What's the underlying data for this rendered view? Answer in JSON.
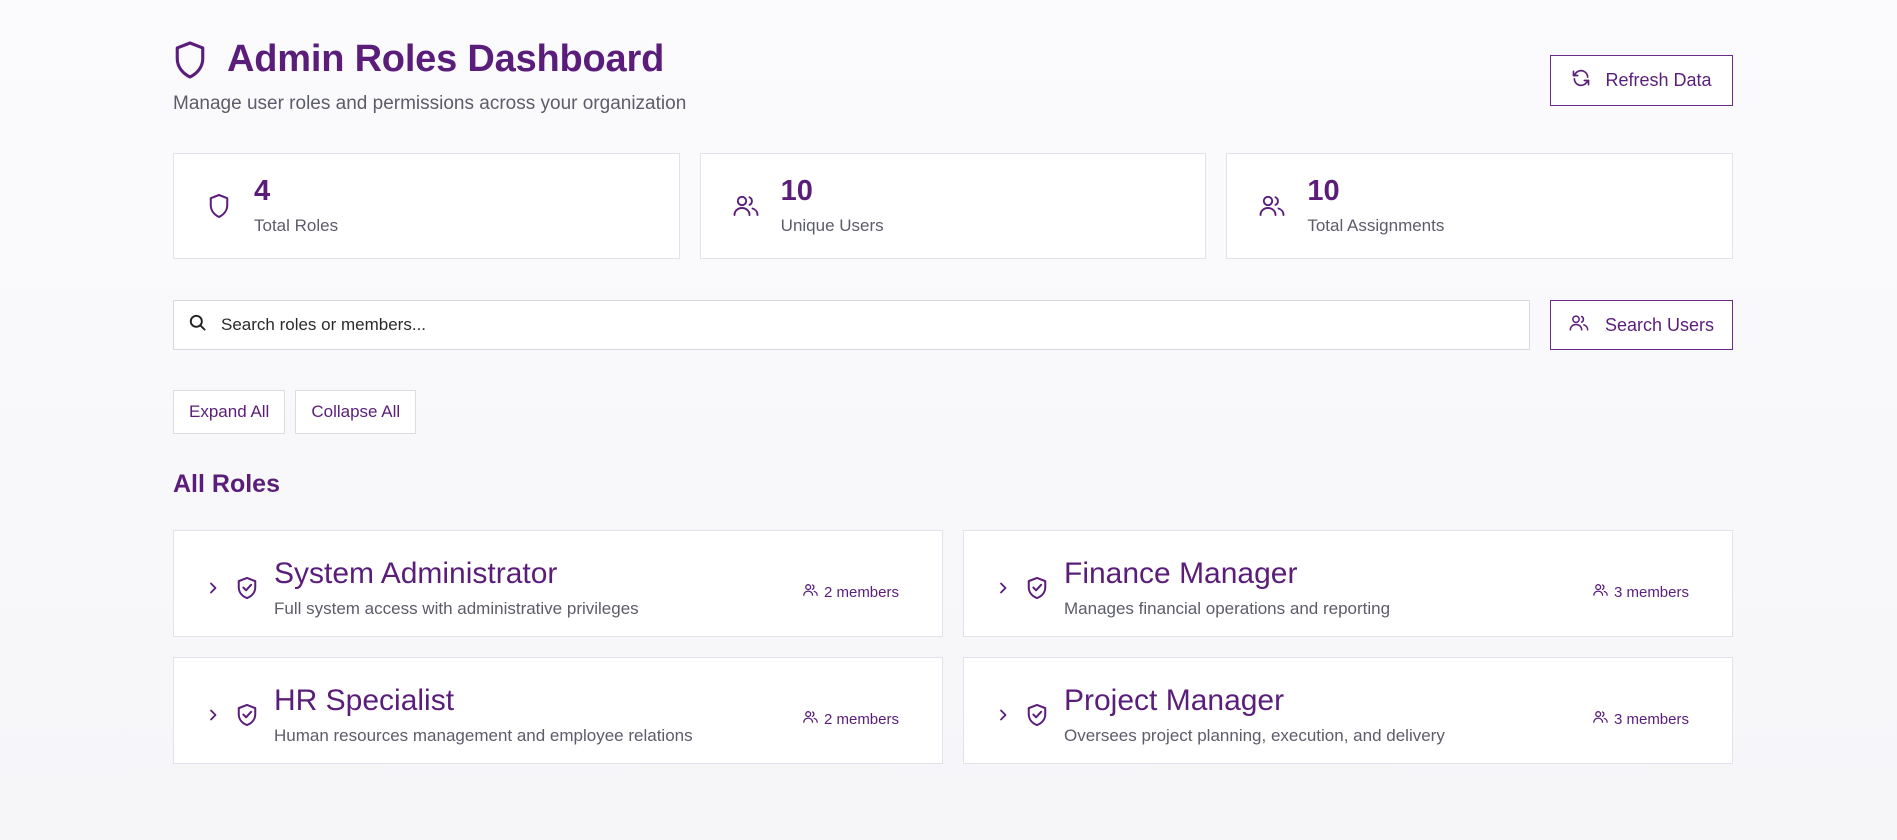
{
  "header": {
    "title": "Admin Roles Dashboard",
    "subtitle": "Manage user roles and permissions across your organization",
    "refresh_label": "Refresh Data"
  },
  "stats": [
    {
      "value": "4",
      "label": "Total Roles",
      "icon": "shield-icon"
    },
    {
      "value": "10",
      "label": "Unique Users",
      "icon": "users-icon"
    },
    {
      "value": "10",
      "label": "Total Assignments",
      "icon": "users-icon"
    }
  ],
  "search": {
    "placeholder": "Search roles or members...",
    "value": "",
    "search_users_label": "Search Users"
  },
  "toggles": {
    "expand_all": "Expand All",
    "collapse_all": "Collapse All"
  },
  "section_title": "All Roles",
  "roles": [
    {
      "name": "System Administrator",
      "description": "Full system access with administrative privileges",
      "members": "2 members"
    },
    {
      "name": "Finance Manager",
      "description": "Manages financial operations and reporting",
      "members": "3 members"
    },
    {
      "name": "HR Specialist",
      "description": "Human resources management and employee relations",
      "members": "2 members"
    },
    {
      "name": "Project Manager",
      "description": "Oversees project planning, execution, and delivery",
      "members": "3 members"
    }
  ],
  "colors": {
    "accent": "#5a1e7a",
    "border": "#e2e2ea",
    "muted_text": "#5c5c6a"
  }
}
